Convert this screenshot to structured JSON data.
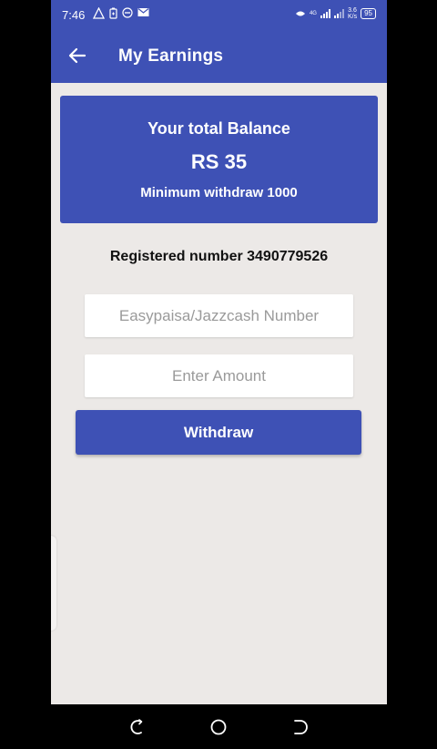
{
  "status_bar": {
    "time": "7:46",
    "left_icons": [
      "warning-triangle-icon",
      "battery-saver-icon",
      "dnd-icon",
      "mail-icon"
    ],
    "network": "4G",
    "net_speed_value": "3.6",
    "net_speed_unit": "K/s",
    "battery": "95"
  },
  "app_bar": {
    "title": "My Earnings",
    "back_icon": "arrow-left-icon"
  },
  "balance_card": {
    "label": "Your total Balance",
    "amount": "RS 35",
    "minimum": "Minimum withdraw 1000"
  },
  "registered_number": "Registered number 3490779526",
  "form": {
    "number_placeholder": "Easypaisa/Jazzcash Number",
    "amount_placeholder": "Enter Amount",
    "withdraw_label": "Withdraw"
  },
  "nav_bar": {
    "icons": [
      "recents-icon",
      "home-icon",
      "back-icon"
    ]
  },
  "colors": {
    "primary": "#3E51B5",
    "background": "#ECE9E7",
    "placeholder": "#9a9a9a"
  }
}
